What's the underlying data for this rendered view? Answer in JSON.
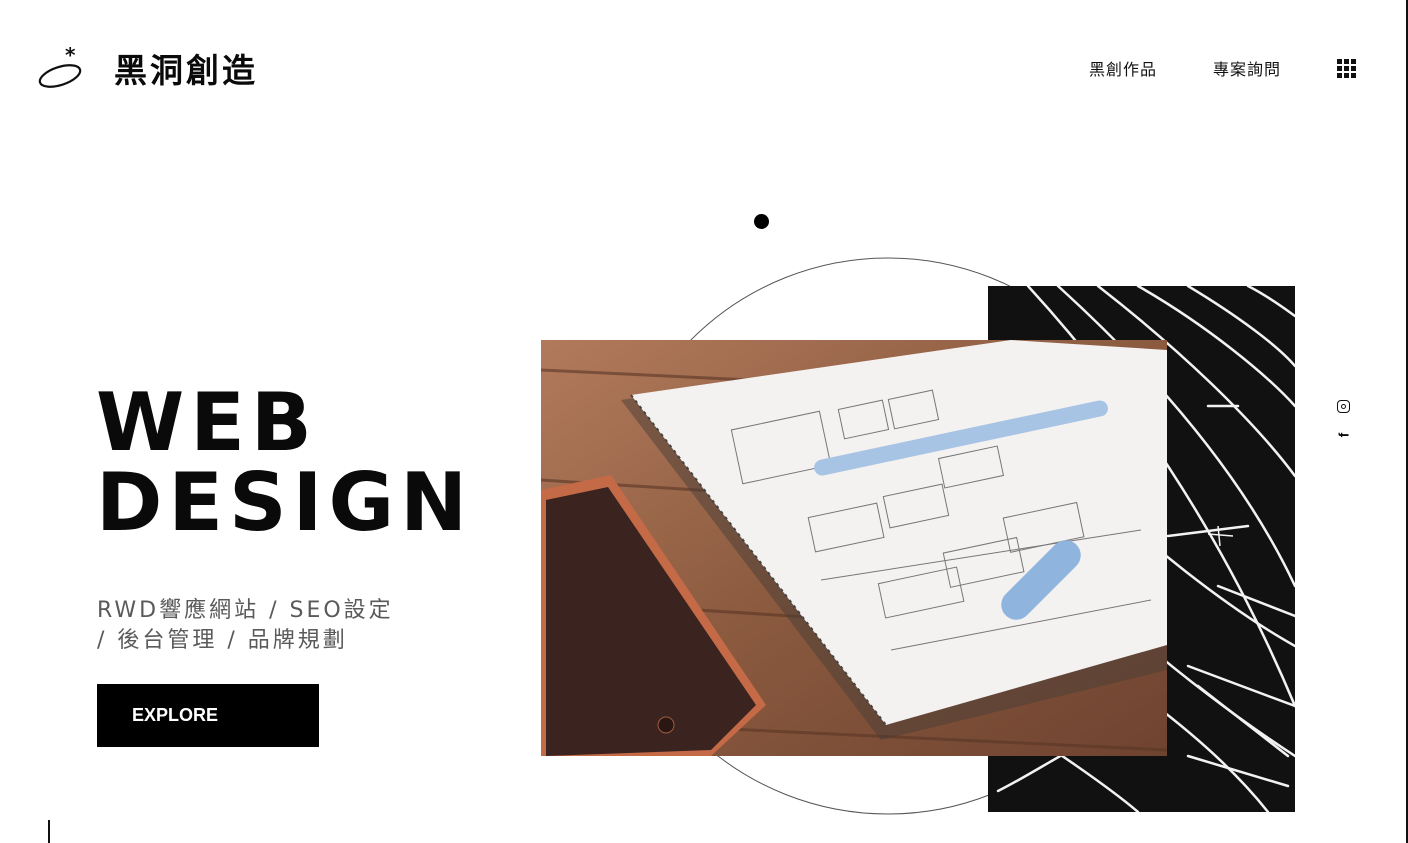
{
  "header": {
    "brand": "黑洞創造",
    "nav": [
      "黑創作品",
      "專案詢問"
    ],
    "menu_icon": "grid-menu-icon"
  },
  "hero": {
    "title_line1": "WEB",
    "title_line2": "DESIGN",
    "subtitle_line1": "RWD響應網站 / SEO設定",
    "subtitle_line2": "/ 後台管理 / 品牌規劃",
    "cta_label": "EXPLORE"
  },
  "social": {
    "instagram_icon": "instagram-icon",
    "facebook_label": "f"
  },
  "colors": {
    "text": "#0a0a0a",
    "accent": "#000000",
    "subtitle": "#5a5a5a",
    "panel": "#111111"
  }
}
